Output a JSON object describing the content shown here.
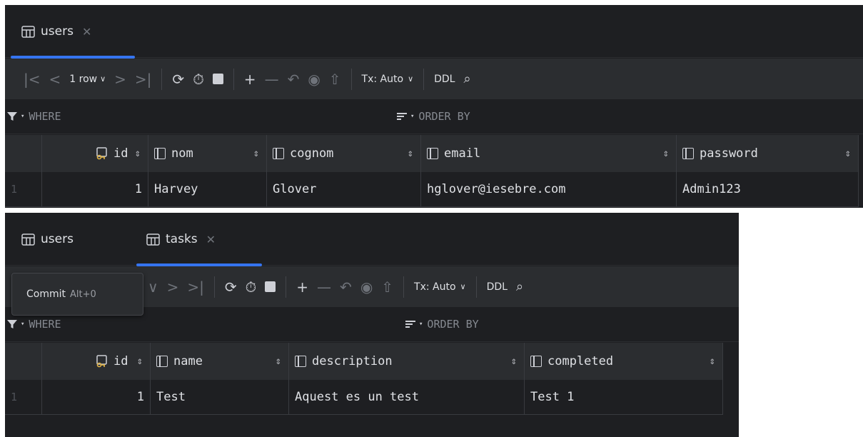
{
  "panels": [
    {
      "tabs": [
        {
          "label": "users",
          "active": true,
          "closable": true
        }
      ],
      "toolbar": {
        "row_count": "1 row",
        "tx_mode": "Tx: Auto",
        "ddl": "DDL"
      },
      "filter": {
        "where": "WHERE",
        "order_by": "ORDER BY"
      },
      "columns": [
        {
          "name": "id",
          "icon": "primary-key-icon"
        },
        {
          "name": "nom",
          "icon": "column-icon"
        },
        {
          "name": "cognom",
          "icon": "column-icon"
        },
        {
          "name": "email",
          "icon": "column-icon"
        },
        {
          "name": "password",
          "icon": "column-icon"
        }
      ],
      "rows": [
        {
          "num": "1",
          "cells": [
            "1",
            "Harvey",
            "Glover",
            "hglover@iesebre.com",
            "Admin123"
          ]
        }
      ]
    },
    {
      "tabs": [
        {
          "label": "users",
          "active": false,
          "closable": false
        },
        {
          "label": "tasks",
          "active": true,
          "closable": true
        }
      ],
      "toolbar": {
        "tx_mode": "Tx: Auto",
        "ddl": "DDL"
      },
      "tooltip": {
        "label": "Commit",
        "shortcut": "Alt+0"
      },
      "filter": {
        "where": "WHERE",
        "order_by": "ORDER BY"
      },
      "columns": [
        {
          "name": "id",
          "icon": "primary-key-icon"
        },
        {
          "name": "name",
          "icon": "column-icon"
        },
        {
          "name": "description",
          "icon": "column-icon"
        },
        {
          "name": "completed",
          "icon": "column-icon"
        }
      ],
      "rows": [
        {
          "num": "1",
          "cells": [
            "1",
            "Test",
            "Aquest es un test",
            "Test 1"
          ]
        }
      ]
    }
  ],
  "colors": {
    "background": "#1e1f22",
    "toolbar": "#2b2d30",
    "accent": "#3574f0",
    "key_icon": "#e0b245"
  }
}
